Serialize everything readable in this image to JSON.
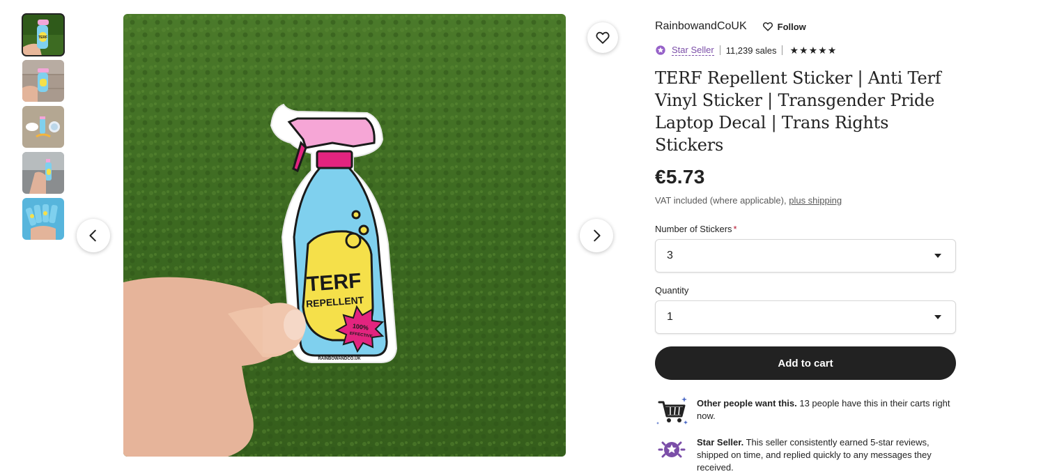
{
  "gallery": {
    "thumbnails": [
      {
        "name": "thumb-1",
        "active": true
      },
      {
        "name": "thumb-2",
        "active": false
      },
      {
        "name": "thumb-3",
        "active": false
      },
      {
        "name": "thumb-4",
        "active": false
      },
      {
        "name": "thumb-5",
        "active": false
      }
    ],
    "sticker_text": {
      "line1": "TERF",
      "line2": "REPELLENT",
      "badge_line1": "100%",
      "badge_line2": "EFFECTIVE",
      "brand": "RAINBOWANDCO.UK"
    },
    "icons": {
      "favorite": "heart-icon",
      "prev": "chevron-left-icon",
      "next": "chevron-right-icon"
    }
  },
  "shop": {
    "name": "RainbowandCoUK",
    "follow_label": "Follow",
    "star_seller_label": "Star Seller",
    "sales": "11,239 sales",
    "rating_stars": 5
  },
  "listing": {
    "title": "TERF Repellent Sticker | Anti Terf Vinyl Sticker | Transgender Pride Laptop Decal | Trans Rights Stickers",
    "price": "€5.73",
    "vat_text": "VAT included (where applicable), ",
    "shipping_link": "plus shipping"
  },
  "options": {
    "stickers_label": "Number of Stickers",
    "required_mark": "*",
    "stickers_value": "3",
    "quantity_label": "Quantity",
    "quantity_value": "1"
  },
  "cart": {
    "button_label": "Add to cart"
  },
  "highlights": [
    {
      "bold": "Other people want this.",
      "text": " 13 people have this in their carts right now."
    },
    {
      "bold": "Star Seller.",
      "text": " This seller consistently earned 5-star reviews, shipped on time, and replied quickly to any messages they received."
    }
  ],
  "colors": {
    "accent_purple": "#7b4ea8",
    "button_dark": "#222222",
    "required_red": "#b3122c",
    "grass": "#3f6b22"
  }
}
